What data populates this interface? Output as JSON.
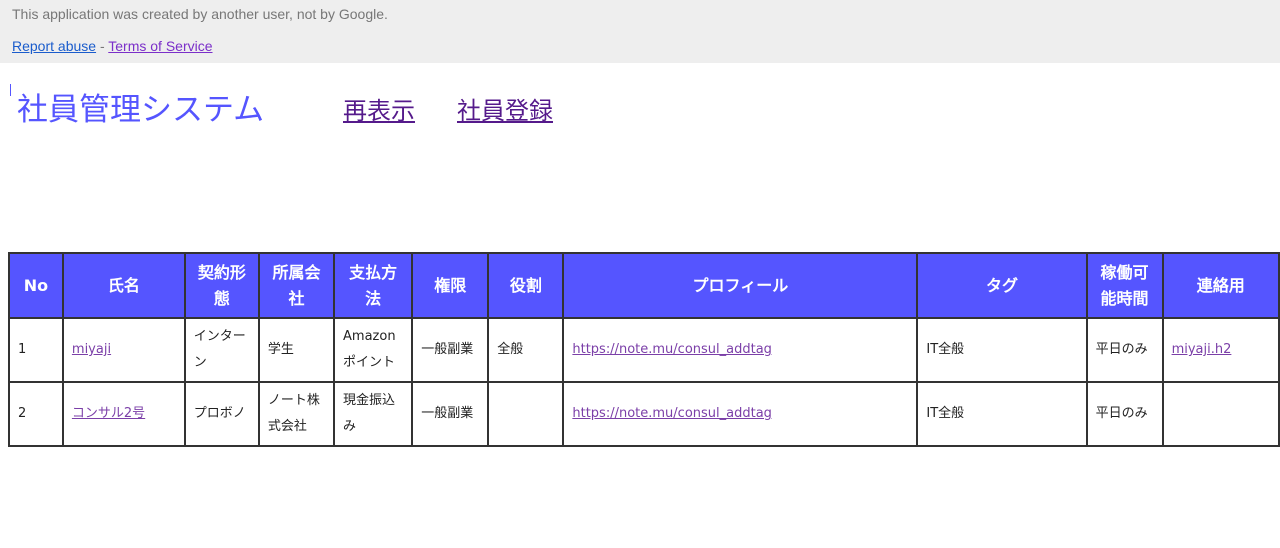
{
  "banner": {
    "message": "This application was created by another user, not by Google.",
    "report_abuse": "Report abuse",
    "separator": " - ",
    "terms": "Terms of Service"
  },
  "header": {
    "title": "社員管理システム",
    "nav": [
      {
        "label": "再表示"
      },
      {
        "label": "社員登録"
      }
    ]
  },
  "colors": {
    "header_bg": "#5555ff",
    "title": "#5555ff",
    "link_visited": "#551a8b"
  },
  "table": {
    "columns": [
      "No",
      "氏名",
      "契約形態",
      "所属会社",
      "支払方法",
      "権限",
      "役割",
      "プロフィール",
      "タグ",
      "稼働可能時間",
      "連絡用"
    ],
    "rows": [
      [
        "1",
        "miyaji",
        "インターン",
        "学生",
        "Amazonポイント",
        "一般副業",
        "全般",
        "https://note.mu/consul_addtag",
        "IT全般",
        "平日のみ",
        "miyaji.h2"
      ],
      [
        "2",
        "コンサル2号",
        "プロボノ",
        "ノート株式会社",
        "現金振込み",
        "一般副業",
        "",
        "https://note.mu/consul_addtag",
        "IT全般",
        "平日のみ",
        ""
      ]
    ]
  }
}
